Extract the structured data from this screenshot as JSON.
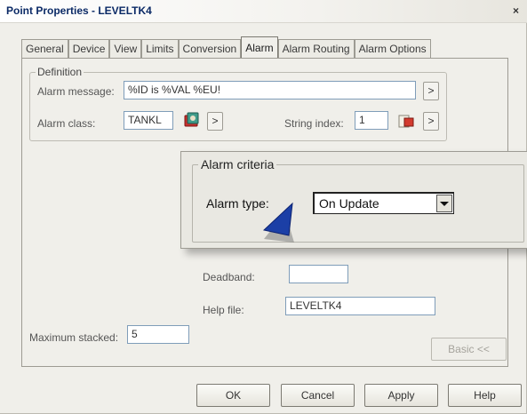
{
  "window": {
    "title": "Point Properties - LEVELTK4",
    "close_label": "×"
  },
  "tabs": [
    {
      "label": "General",
      "active": false
    },
    {
      "label": "Device",
      "active": false
    },
    {
      "label": "View",
      "active": false
    },
    {
      "label": "Limits",
      "active": false
    },
    {
      "label": "Conversion",
      "active": false
    },
    {
      "label": "Alarm",
      "active": true
    },
    {
      "label": "Alarm Routing",
      "active": false
    },
    {
      "label": "Alarm Options",
      "active": false
    }
  ],
  "definition": {
    "legend": "Definition",
    "alarm_message_label": "Alarm message:",
    "alarm_message_value": "%ID is %VAL %EU!",
    "alarm_class_label": "Alarm class:",
    "alarm_class_value": "TANKL",
    "string_index_label": "String index:",
    "string_index_value": "1",
    "arrow_label": ">"
  },
  "criteria": {
    "legend": "Alarm criteria",
    "alarm_type_label": "Alarm type:",
    "alarm_type_value": "On Update"
  },
  "fields": {
    "deadband_label": "Deadband:",
    "deadband_value": "",
    "help_file_label": "Help file:",
    "help_file_value": "LEVELTK4",
    "max_stacked_label": "Maximum stacked:",
    "max_stacked_value": "5"
  },
  "buttons": {
    "basic": "Basic <<",
    "ok": "OK",
    "cancel": "Cancel",
    "apply": "Apply",
    "help": "Help"
  },
  "colors": {
    "title_text": "#0b2a66",
    "cursor_blue": "#1b3fa6"
  }
}
